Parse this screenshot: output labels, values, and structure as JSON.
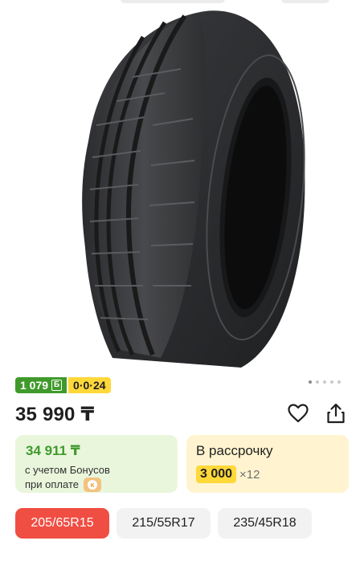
{
  "product": {
    "bonus_badge": "1 079",
    "bonus_symbol": "Б",
    "installment_badge": "0·0·24",
    "price": "35 990 ₸",
    "gallery_dots": 5,
    "gallery_active_index": 0
  },
  "bonus_card": {
    "price": "34 911 ₸",
    "line1": "с учетом Бонусов",
    "line2": "при оплате"
  },
  "installment_card": {
    "title": "В рассрочку",
    "amount": "3 000",
    "multiplier": "×12"
  },
  "sizes": [
    {
      "label": "205/65R15",
      "selected": true
    },
    {
      "label": "215/55R17",
      "selected": false
    },
    {
      "label": "235/45R18",
      "selected": false
    }
  ],
  "icons": {
    "favorite": "heart-icon",
    "share": "share-icon"
  },
  "colors": {
    "bonus_green": "#3f9a2b",
    "installment_yellow": "#ffd83a",
    "selected_red": "#f04e43"
  }
}
